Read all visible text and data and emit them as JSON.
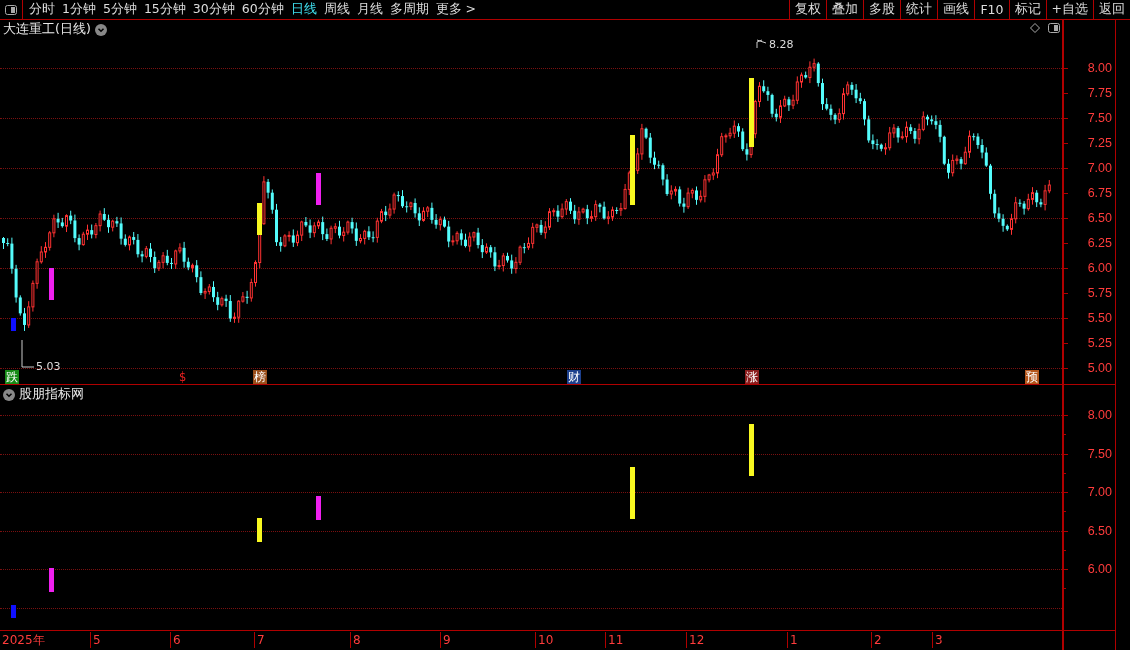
{
  "toolbar": {
    "tabs": [
      {
        "label": "分时",
        "selected": false
      },
      {
        "label": "1分钟",
        "selected": false
      },
      {
        "label": "5分钟",
        "selected": false
      },
      {
        "label": "15分钟",
        "selected": false
      },
      {
        "label": "30分钟",
        "selected": false
      },
      {
        "label": "60分钟",
        "selected": false
      },
      {
        "label": "日线",
        "selected": true
      },
      {
        "label": "周线",
        "selected": false
      },
      {
        "label": "月线",
        "selected": false
      },
      {
        "label": "多周期",
        "selected": false
      },
      {
        "label": "更多 >",
        "selected": false
      }
    ],
    "buttons": [
      "复权",
      "叠加",
      "多股",
      "统计",
      "画线",
      "F10",
      "标记",
      "+自选",
      "返回"
    ]
  },
  "main_chart": {
    "title": "大连重工(日线)",
    "high_label": "8.28",
    "low_label": "5.03",
    "yticks": [
      "8.00",
      "7.75",
      "7.50",
      "7.25",
      "7.00",
      "6.75",
      "6.50",
      "6.25",
      "6.00",
      "5.75",
      "5.50",
      "5.25",
      "5.00"
    ],
    "signals": [
      {
        "label": "跌",
        "kind": "badge",
        "color": "#168a16"
      },
      {
        "label": "$",
        "kind": "text",
        "color": "#e82020"
      },
      {
        "label": "榜",
        "kind": "badge",
        "color": "#9a4e1a"
      },
      {
        "label": "财",
        "kind": "badge",
        "color": "#1c3f8c"
      },
      {
        "label": "涨",
        "kind": "badge",
        "color": "#8c1c1c"
      },
      {
        "label": "预",
        "kind": "badge",
        "color": "#b4561c"
      }
    ]
  },
  "indicator": {
    "title": "股朋指标网",
    "yticks": [
      "8.00",
      "7.50",
      "7.00",
      "6.50",
      "6.00"
    ]
  },
  "date_axis": [
    "2025年",
    "5",
    "6",
    "7",
    "8",
    "9",
    "10",
    "11",
    "12",
    "1",
    "2",
    "3"
  ]
}
